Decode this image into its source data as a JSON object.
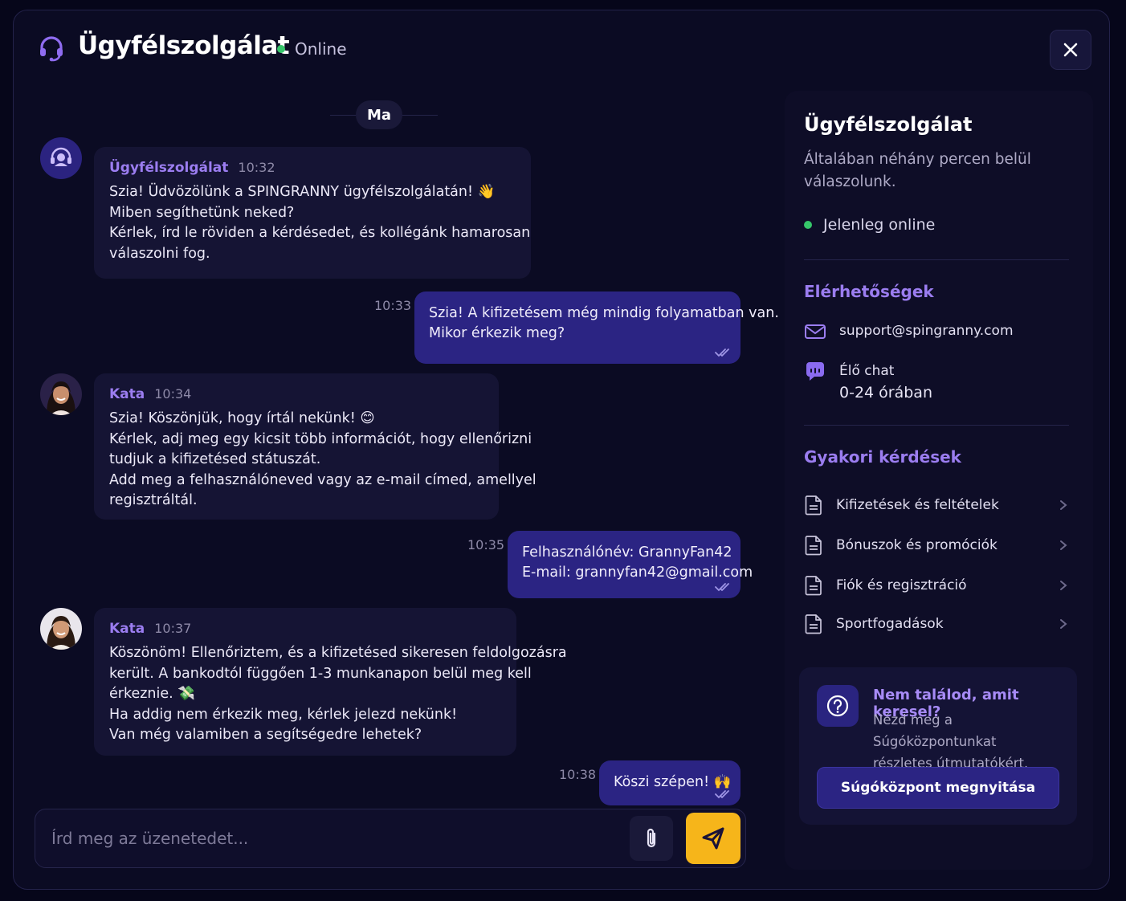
{
  "header": {
    "title": "Ügyfélszolgálat",
    "status": "Online",
    "close_label": "✕"
  },
  "chat": {
    "day_label": "Ma",
    "messages": [
      {
        "sender": "Ügyfélszolgálat",
        "time": "10:32",
        "lines": [
          "Szia! Üdvözölünk a SPINGRANNY ügyfélszolgálatán! 👋",
          "Miben segíthetünk neked?",
          "Kérlek, írd le röviden a kérdésedet, és kollégánk hamarosan",
          "válaszolni fog."
        ]
      },
      {
        "time": "10:33",
        "lines": [
          "Szia! A kifizetésem még mindig folyamatban van.",
          "Mikor érkezik meg?"
        ]
      },
      {
        "sender": "Kata",
        "time": "10:34",
        "lines": [
          "Szia! Köszönjük, hogy írtál nekünk! 😊",
          "Kérlek, adj meg egy kicsit több információt, hogy ellenőrizni",
          "tudjuk a kifizetésed státuszát.",
          "Add meg a felhasználóneved vagy az e-mail címed, amellyel",
          "regisztráltál."
        ]
      },
      {
        "time": "10:35",
        "lines": [
          "Felhasználónév: GrannyFan42",
          "E-mail: grannyfan42@gmail.com"
        ]
      },
      {
        "sender": "Kata",
        "time": "10:37",
        "lines": [
          "Köszönöm! Ellenőriztem, és a kifizetésed sikeresen feldolgozásra",
          "került. A bankodtól függően 1-3 munkanapon belül meg kell",
          "érkeznie. 💸",
          "Ha addig nem érkezik meg, kérlek jelezd nekünk!",
          "Van még valamiben a segítségedre lehetek?"
        ]
      },
      {
        "time": "10:38",
        "lines": [
          "Köszi szépen! 🙌"
        ]
      }
    ],
    "input_placeholder": "Írd meg az üzenetedet..."
  },
  "panel": {
    "title": "Ügyfélszolgálat",
    "subtitle_lines": [
      "Általában néhány percen belül",
      "válaszolunk."
    ],
    "online_text": "Jelenleg online",
    "contacts_heading": "Elérhetőségek",
    "email": "support@spingranny.com",
    "live_chat_label": "Élő chat",
    "live_chat_hours": "0-24 órában",
    "faq_heading": "Gyakori kérdések",
    "faq_items": [
      "Kifizetések és feltételek",
      "Bónuszok és promóciók",
      "Fiók és regisztráció",
      "Sportfogadások"
    ],
    "help": {
      "heading": "Nem találod, amit keresel?",
      "body_lines": [
        "Nézd meg a Súgóközpontunkat",
        "részletes útmutatókért."
      ],
      "button": "Súgóközpont megnyitása"
    }
  },
  "colors": {
    "background": "#0b0b23",
    "accent_purple": "#9b7df0",
    "outgoing_bubble": "#2b2483",
    "send_button": "#f6b51a",
    "online": "#36c66a"
  }
}
